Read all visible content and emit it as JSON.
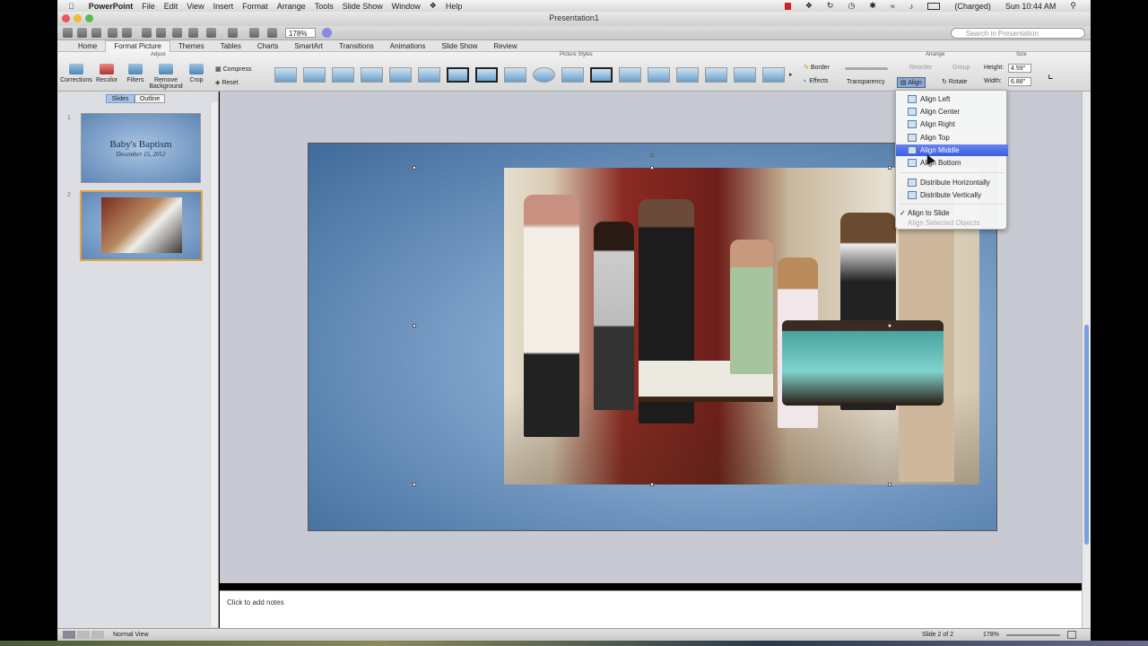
{
  "menubar": {
    "app": "PowerPoint",
    "items": [
      "File",
      "Edit",
      "View",
      "Insert",
      "Format",
      "Arrange",
      "Tools",
      "Slide Show",
      "Window",
      "Help"
    ],
    "battery": "(Charged)",
    "clock": "Sun 10:44 AM"
  },
  "window": {
    "title": "Presentation1"
  },
  "toolbar": {
    "zoom": "178%",
    "search_placeholder": "Search in Presentation"
  },
  "ribbon_tabs": [
    "Home",
    "Format Picture",
    "Themes",
    "Tables",
    "Charts",
    "SmartArt",
    "Transitions",
    "Animations",
    "Slide Show",
    "Review"
  ],
  "ribbon": {
    "groups": {
      "adjust": "Adjust",
      "picture_styles": "Picture Styles",
      "arrange": "Arrange",
      "size": "Size"
    },
    "adjust_buttons": [
      "Corrections",
      "Recolor",
      "Filters",
      "Remove Background",
      "Crop"
    ],
    "compress": "Compress",
    "reset": "Reset",
    "border": "Border",
    "effects": "Effects",
    "transparency": "Transparency",
    "reorder": "Reorder",
    "group": "Group",
    "align": "Align",
    "rotate": "Rotate",
    "height_label": "Height:",
    "height_value": "4.59\"",
    "width_label": "Width:",
    "width_value": "6.88\""
  },
  "sidebar": {
    "tabs": [
      "Slides",
      "Outline"
    ],
    "slides": [
      {
        "num": "1",
        "title": "Baby's Baptism",
        "subtitle": "December 15, 2012"
      },
      {
        "num": "2"
      }
    ]
  },
  "notes": {
    "placeholder": "Click to add notes"
  },
  "status": {
    "view": "Normal View",
    "slide": "Slide 2 of 2",
    "zoom": "178%"
  },
  "align_menu": {
    "items": [
      "Align Left",
      "Align Center",
      "Align Right",
      "Align Top",
      "Align Middle",
      "Align Bottom"
    ],
    "distribute": [
      "Distribute Horizontally",
      "Distribute Vertically"
    ],
    "align_to_slide": "Align to Slide",
    "align_selected": "Align Selected Objects",
    "checkmark": "✓"
  }
}
